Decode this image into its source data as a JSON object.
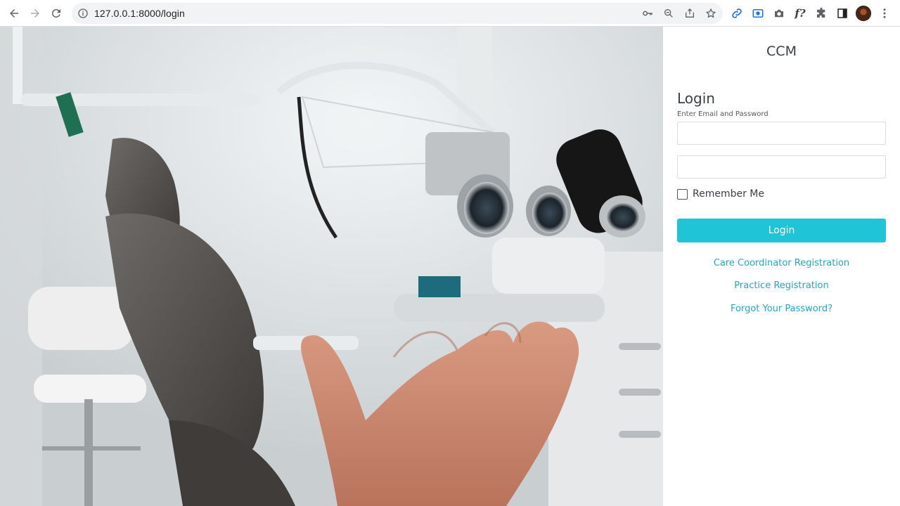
{
  "browser": {
    "url": "127.0.0.1:8000/login",
    "icons": {
      "back": "arrow-left-icon",
      "forward": "arrow-right-icon",
      "reload": "reload-icon",
      "site_info": "info-icon",
      "password_key": "key-icon",
      "zoom": "zoom-icon",
      "share": "share-icon",
      "bookmark": "star-icon",
      "ext_link": "link-icon",
      "ext_record": "record-icon",
      "ext_camera": "camera-icon",
      "ext_formula": "formula-icon",
      "extensions": "puzzle-icon",
      "side_panel": "side-panel-icon",
      "menu": "kebab-menu-icon"
    },
    "ext_formula_label": "f?"
  },
  "login": {
    "brand": "CCM",
    "title": "Login",
    "subtitle": "Enter Email and Password",
    "email_value": "",
    "password_value": "",
    "remember_label": "Remember Me",
    "remember_checked": false,
    "submit_label": "Login",
    "links": {
      "care_coordinator": "Care Coordinator Registration",
      "practice": "Practice Registration",
      "forgot": "Forgot Your Password?"
    }
  },
  "colors": {
    "accent": "#1fc4d6",
    "link": "#1fa9c8",
    "text": "#3a3f44"
  }
}
